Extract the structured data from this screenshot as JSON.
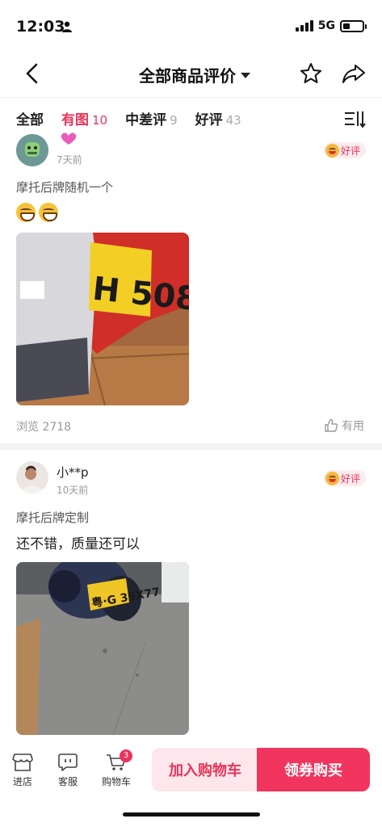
{
  "status": {
    "time": "12:03",
    "network": "5G",
    "battery_level": 0.35
  },
  "nav": {
    "title": "全部商品评价"
  },
  "tabs": [
    {
      "label": "全部",
      "count": ""
    },
    {
      "label": "有图",
      "count": "10"
    },
    {
      "label": "中差评",
      "count": "9"
    },
    {
      "label": "好评",
      "count": "43"
    }
  ],
  "active_tab": 1,
  "reviews": [
    {
      "name": "",
      "time": "7天前",
      "rating_label": "好评",
      "spec": "摩托后牌随机一个",
      "text": "",
      "emoji": [
        "grin-emoji",
        "grin-emoji"
      ],
      "plate_text": "H 508",
      "views": "浏览 2718",
      "like_label": "有用"
    },
    {
      "name": "小**p",
      "time": "10天前",
      "rating_label": "好评",
      "spec": "摩托后牌定制",
      "text": "还不错，质量还可以",
      "plate_text": "粤·G 35X77"
    }
  ],
  "bottom_bar": {
    "shop_label": "进店",
    "service_label": "客服",
    "cart_label": "购物车",
    "cart_count": "3",
    "add_cart_label": "加入购物车",
    "buy_label": "领券购买"
  },
  "colors": {
    "accent": "#e8345a",
    "accent_light": "#fde7ec",
    "plate_yellow": "#f3cf26"
  }
}
